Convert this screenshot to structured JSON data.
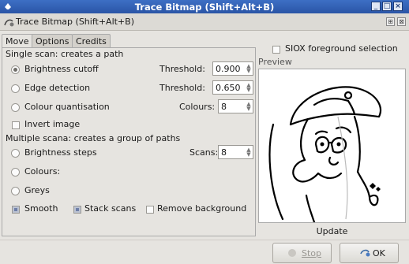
{
  "window": {
    "title": "Trace Bitmap (Shift+Alt+B)",
    "buttons": [
      "_",
      "□",
      "×"
    ]
  },
  "dock": {
    "label": "Trace Bitmap (Shift+Alt+B)",
    "buttons": [
      "⊞",
      "⊠"
    ]
  },
  "tabs": [
    {
      "label": "Move"
    },
    {
      "label": "Options"
    },
    {
      "label": "Credits"
    }
  ],
  "single_scan": {
    "header": "Single scan: creates a path",
    "brightness_cutoff": {
      "label": "Brightness cutoff",
      "threshold_label": "Threshold:",
      "threshold_value": "0.900"
    },
    "edge_detection": {
      "label": "Edge detection",
      "threshold_label": "Threshold:",
      "threshold_value": "0.650"
    },
    "colour_quantisation": {
      "label": "Colour quantisation",
      "colours_label": "Colours:",
      "colours_value": "8"
    },
    "invert_image": "Invert image"
  },
  "multiple_scans": {
    "header": "Multiple scana: creates a group of paths",
    "brightness_steps": {
      "label": "Brightness steps",
      "scans_label": "Scans:",
      "scans_value": "8"
    },
    "colours": "Colours:",
    "greys": "Greys",
    "smooth": "Smooth",
    "stack_scans": "Stack scans",
    "remove_background": "Remove background"
  },
  "siox": "SIOX foreground selection",
  "preview": {
    "label": "Preview",
    "update": "Update"
  },
  "footer": {
    "stop": "Stop",
    "ok": "OK"
  }
}
